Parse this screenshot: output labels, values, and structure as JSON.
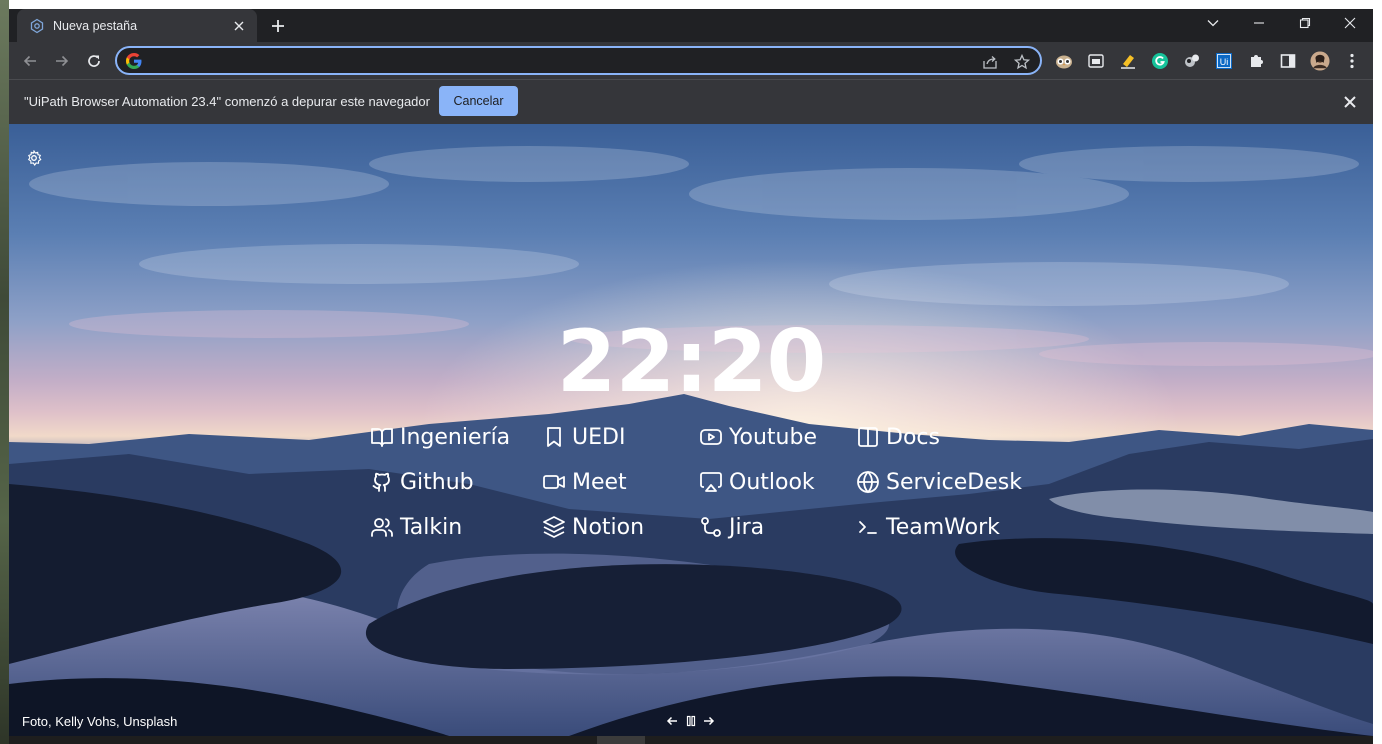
{
  "browser": {
    "tab_title": "Nueva pestaña",
    "address_value": "",
    "address_placeholder": ""
  },
  "infobar": {
    "message": "\"UiPath Browser Automation 23.4\" comenzó a depurar este navegador",
    "cancel_label": "Cancelar"
  },
  "newtab": {
    "clock": "22:20",
    "photo_credit": "Foto, Kelly Vohs, Unsplash",
    "links": [
      {
        "label": "Ingeniería",
        "icon": "book-open-icon"
      },
      {
        "label": "UEDI",
        "icon": "bookmark-icon"
      },
      {
        "label": "Youtube",
        "icon": "youtube-icon"
      },
      {
        "label": "Docs",
        "icon": "columns-icon"
      },
      {
        "label": "Github",
        "icon": "github-icon"
      },
      {
        "label": "Meet",
        "icon": "video-icon"
      },
      {
        "label": "Outlook",
        "icon": "airplay-icon"
      },
      {
        "label": "ServiceDesk",
        "icon": "globe-icon"
      },
      {
        "label": "Talkin",
        "icon": "users-icon"
      },
      {
        "label": "Notion",
        "icon": "layers-icon"
      },
      {
        "label": "Jira",
        "icon": "git-commit-icon"
      },
      {
        "label": "TeamWork",
        "icon": "terminal-icon"
      }
    ]
  },
  "colors": {
    "accent": "#8ab4f8",
    "toolbar": "#35363a",
    "frame": "#202124"
  }
}
